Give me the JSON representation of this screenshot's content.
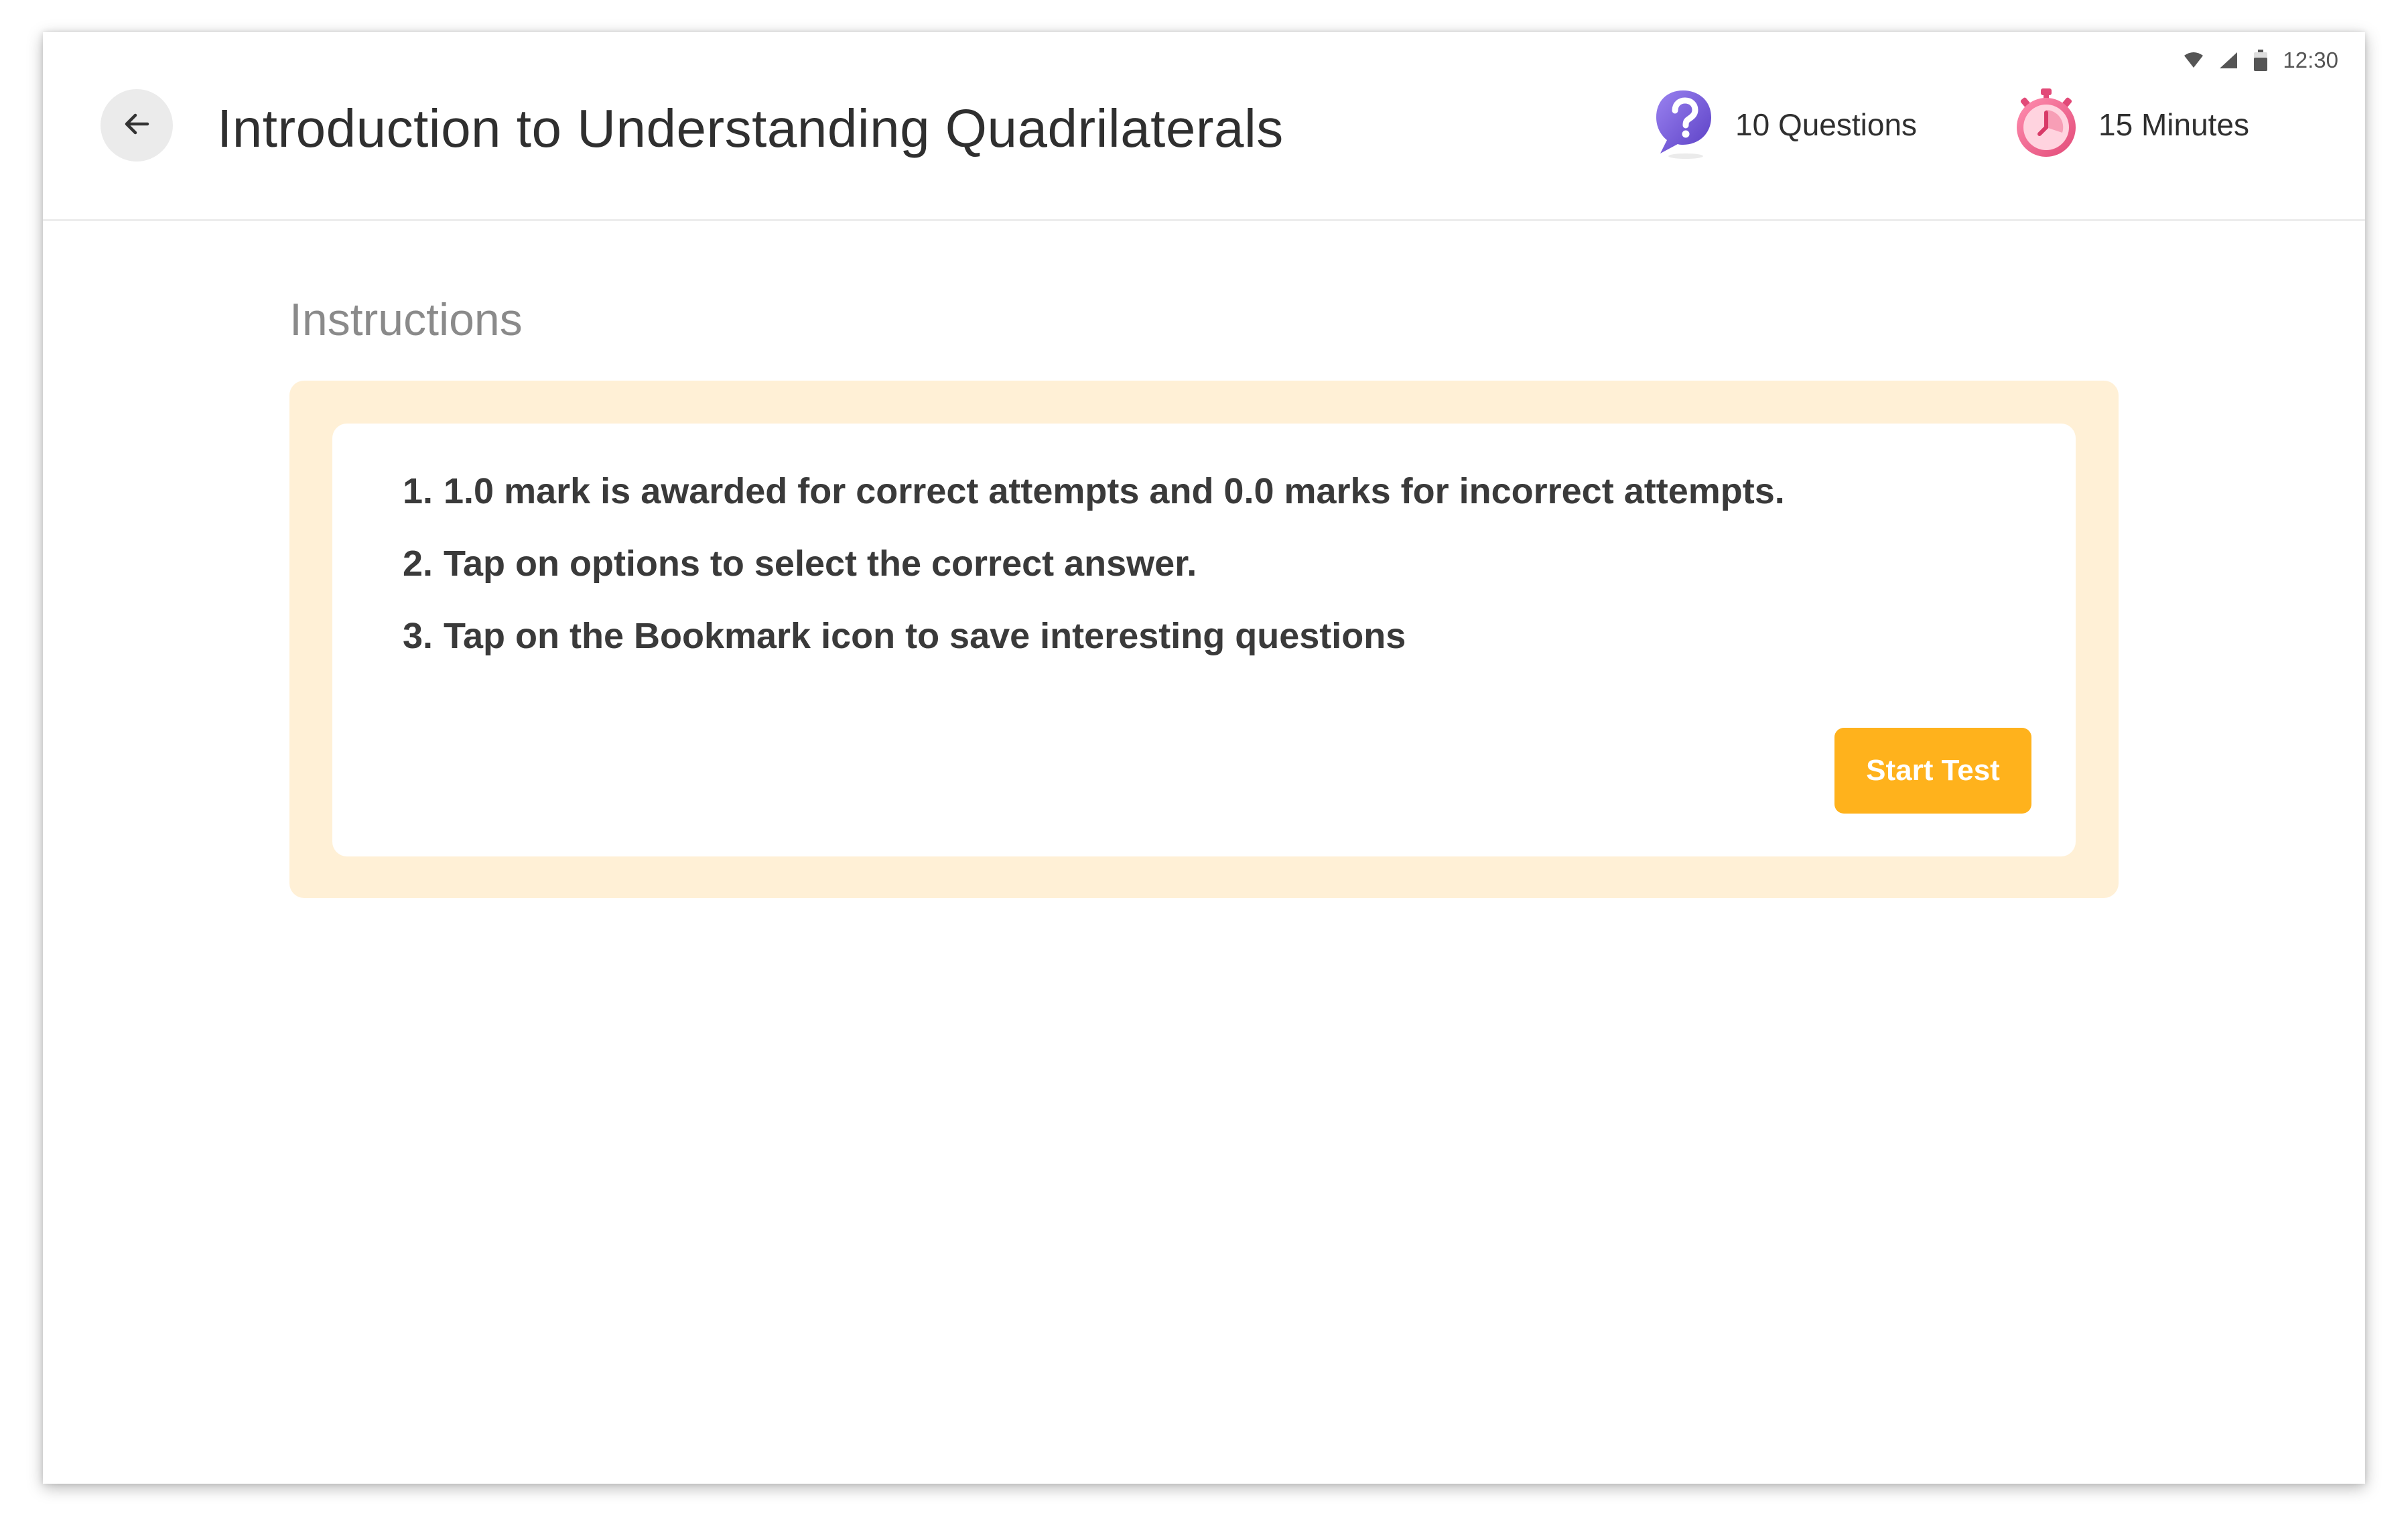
{
  "status_bar": {
    "time": "12:30",
    "icons": [
      "wifi-icon",
      "signal-icon",
      "battery-icon"
    ]
  },
  "header": {
    "back_icon": "arrow-left-icon",
    "title": "Introduction to Understanding Quadrilaterals",
    "questions": {
      "icon": "question-bubble-icon",
      "label": "10 Questions"
    },
    "duration": {
      "icon": "stopwatch-icon",
      "label": "15 Minutes"
    }
  },
  "instructions": {
    "heading": "Instructions",
    "items": [
      {
        "number": "1.",
        "text": "1.0 mark is awarded for correct attempts and 0.0 marks for incorrect attempts."
      },
      {
        "number": "2.",
        "text": "Tap on options to select the correct answer."
      },
      {
        "number": "3.",
        "text": "Tap on the Bookmark icon to save interesting questions"
      }
    ],
    "start_button_label": "Start Test"
  },
  "colors": {
    "accent": "#ffb21c",
    "panel_background": "#fff0d6",
    "question_icon": "#7b5cd6",
    "stopwatch_icon": "#f06a8e"
  }
}
